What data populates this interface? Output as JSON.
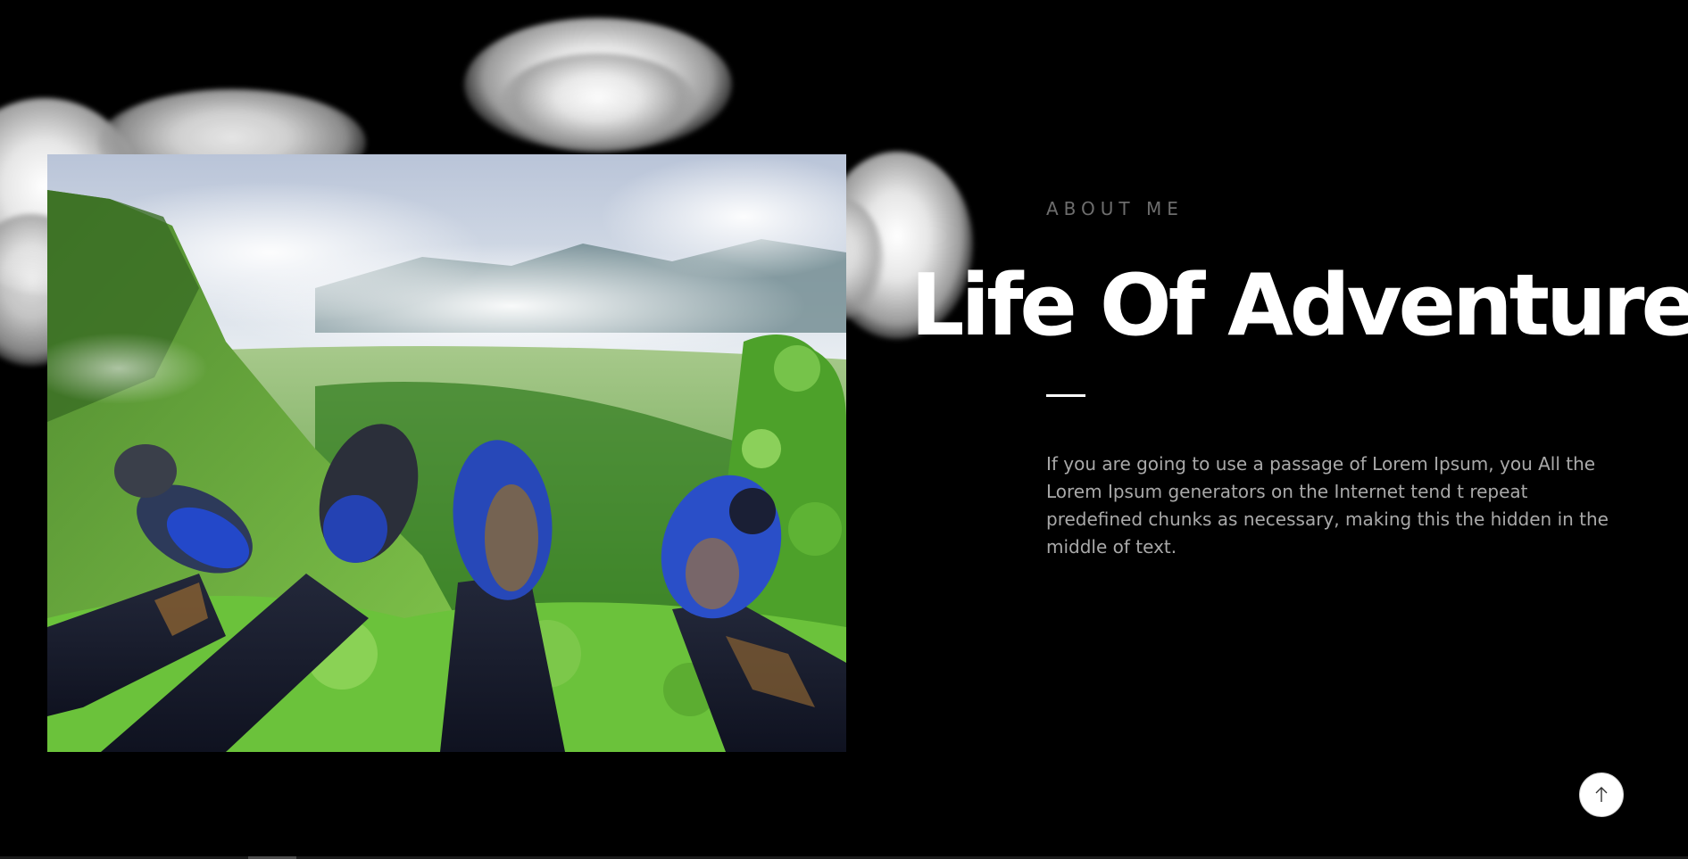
{
  "about": {
    "label": "ABOUT ME",
    "title": "Life Of Adventure",
    "body": "If you are going to use a passage of Lorem Ipsum, you All the Lorem Ipsum generators on the Internet tend t repeat predefined chunks as necessary, making this the hidden in the middle of text."
  },
  "scroll_top": {
    "icon": "arrow-up-icon"
  },
  "colors": {
    "background": "#000000",
    "title": "#ffffff",
    "label": "#6d6d6d",
    "body": "#a9a9a9",
    "button": "#ffffff"
  }
}
